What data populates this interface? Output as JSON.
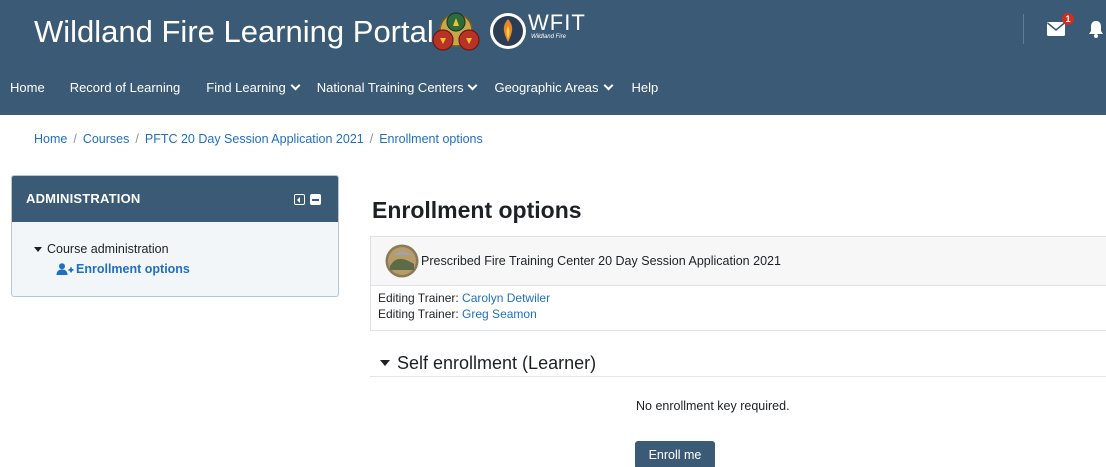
{
  "header": {
    "site_title": "Wildland Fire Learning Portal",
    "wfit_logo_text": "WFIT",
    "wfit_logo_subtext": "Wildland Fire",
    "mail_badge_count": "1",
    "nav": [
      {
        "label": "Home"
      },
      {
        "label": "Record of Learning"
      },
      {
        "label": "Find Learning"
      },
      {
        "label": "National Training Centers"
      },
      {
        "label": "Geographic Areas"
      },
      {
        "label": "Help"
      }
    ]
  },
  "breadcrumb": [
    {
      "label": "Home"
    },
    {
      "label": "Courses"
    },
    {
      "label": "PFTC 20 Day Session Application 2021"
    },
    {
      "label": "Enrollment options"
    }
  ],
  "admin_block": {
    "title": "ADMINISTRATION",
    "tree_label": "Course administration",
    "link_label": "Enrollment options"
  },
  "main": {
    "page_title": "Enrollment options",
    "course": {
      "name": "Prescribed Fire Training Center 20 Day Session Application 2021",
      "trainers": [
        {
          "role": "Editing Trainer:",
          "name": "Carolyn Detwiler"
        },
        {
          "role": "Editing Trainer:",
          "name": "Greg Seamon"
        }
      ]
    },
    "enrollment": {
      "section_title": "Self enrollment (Learner)",
      "no_key_text": "No enrollment key required.",
      "button_label": "Enroll me"
    }
  },
  "colors": {
    "brand_navy": "#3a5a76",
    "link_blue": "#1f6fc5",
    "badge_red": "#ca3120"
  }
}
